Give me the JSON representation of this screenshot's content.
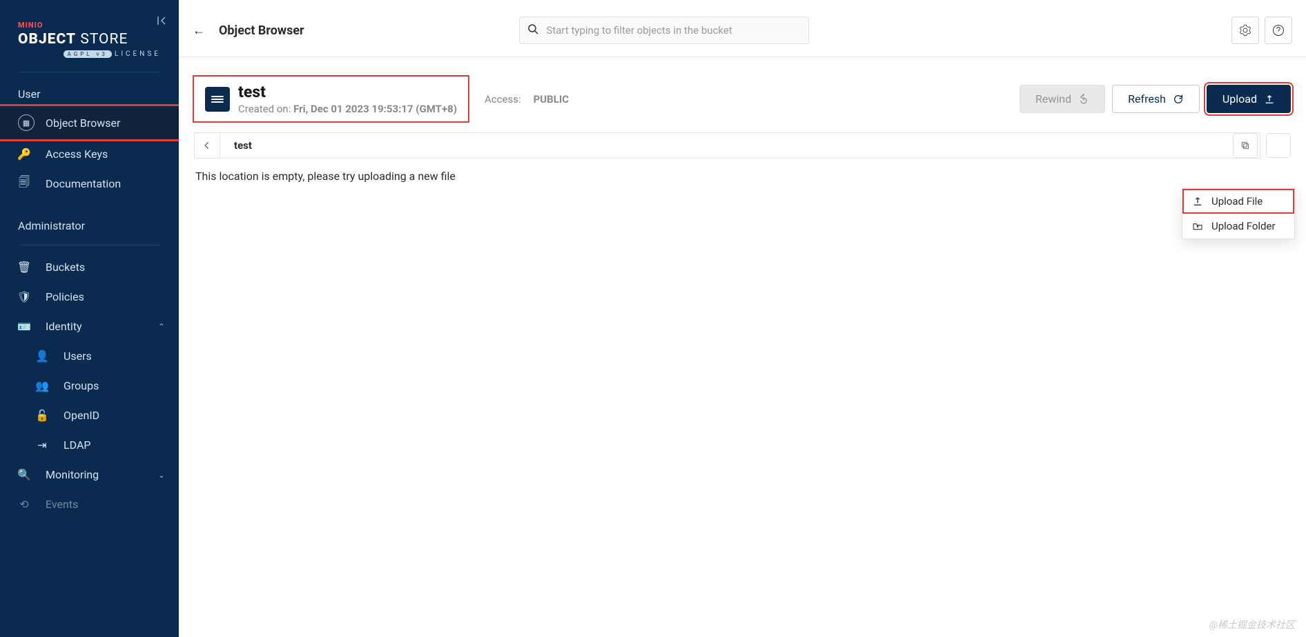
{
  "logo": {
    "brand": "MINIO",
    "main_bold": "OBJECT",
    "main_light": "STORE",
    "license_badge": "AGPL v3",
    "license_text": "LICENSE"
  },
  "sidebar": {
    "user_section": "User",
    "admin_section": "Administrator",
    "items": {
      "object_browser": "Object Browser",
      "access_keys": "Access Keys",
      "documentation": "Documentation",
      "buckets": "Buckets",
      "policies": "Policies",
      "identity": "Identity",
      "users": "Users",
      "groups": "Groups",
      "openid": "OpenID",
      "ldap": "LDAP",
      "monitoring": "Monitoring",
      "events": "Events"
    }
  },
  "header": {
    "title": "Object Browser",
    "search_placeholder": "Start typing to filter objects in the bucket"
  },
  "bucket": {
    "name": "test",
    "created_label": "Created on: ",
    "created_value": "Fri, Dec 01 2023 19:53:17 (GMT+8)",
    "access_label": "Access:",
    "access_value": "PUBLIC"
  },
  "actions": {
    "rewind": "Rewind",
    "refresh": "Refresh",
    "upload": "Upload"
  },
  "breadcrumb": {
    "current": "test"
  },
  "empty_message": "This location is empty, please try uploading a new file",
  "upload_menu": {
    "file": "Upload File",
    "folder": "Upload Folder"
  },
  "watermark": "@稀土掘金技术社区"
}
